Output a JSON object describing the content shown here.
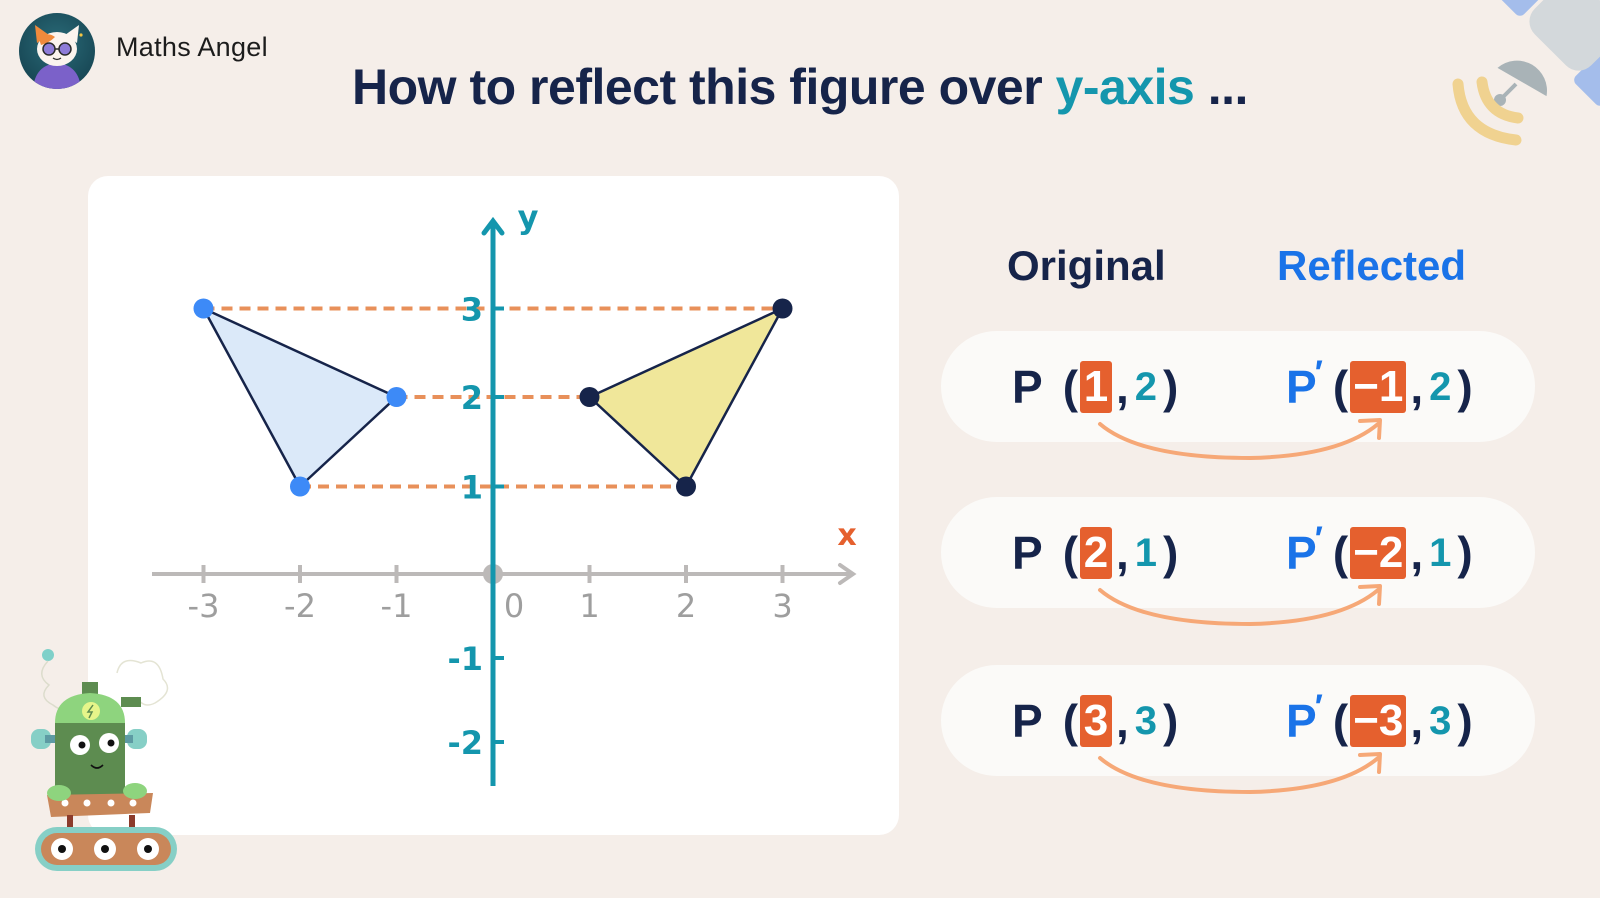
{
  "brand": {
    "name": "Maths Angel",
    "logo_icon": "cat-with-sunglasses-avatar"
  },
  "title": {
    "prefix": "How to reflect this figure over ",
    "highlight": "y-axis",
    "suffix": " ..."
  },
  "decorations": {
    "top_right": "satellite-icon",
    "bottom_left": "robot-mascot-icon"
  },
  "colors": {
    "background": "#f5eee9",
    "title": "#16244a",
    "accent_teal": "#1496ad",
    "accent_blue": "#1a73e8",
    "highlight_orange": "#e5602e",
    "dashed_orange": "#e8905a",
    "original_fill": "#dbe9f9",
    "reflected_fill": "#f0e79a"
  },
  "table": {
    "headers": {
      "original": "Original",
      "reflected": "Reflected"
    },
    "rows": [
      {
        "orig_name": "P",
        "orig_x": "1",
        "orig_y": "2",
        "refl_name": "P",
        "refl_prime": "′",
        "refl_x": "−1",
        "refl_y": "2"
      },
      {
        "orig_name": "P",
        "orig_x": "2",
        "orig_y": "1",
        "refl_name": "P",
        "refl_prime": "′",
        "refl_x": "−2",
        "refl_y": "1"
      },
      {
        "orig_name": "P",
        "orig_x": "3",
        "orig_y": "3",
        "refl_name": "P",
        "refl_prime": "′",
        "refl_x": "−3",
        "refl_y": "3"
      }
    ]
  },
  "chart_data": {
    "type": "scatter",
    "title": "",
    "xlabel": "x",
    "ylabel": "y",
    "xlim": [
      -3.5,
      3.8
    ],
    "ylim": [
      -2.4,
      3.6
    ],
    "x_ticks": [
      "-3",
      "-2",
      "-1",
      "0",
      "1",
      "2",
      "3"
    ],
    "y_ticks": [
      "3",
      "2",
      "1",
      "-1",
      "-2"
    ],
    "origin_label": "0",
    "grid": false,
    "series": [
      {
        "name": "original",
        "shape": "triangle",
        "points": [
          [
            -3,
            3
          ],
          [
            -1,
            2
          ],
          [
            -2,
            1
          ]
        ],
        "fill": "#dbe9f9",
        "point_color": "#3d8af7"
      },
      {
        "name": "reflected",
        "shape": "triangle",
        "points": [
          [
            3,
            3
          ],
          [
            1,
            2
          ],
          [
            2,
            1
          ]
        ],
        "fill": "#f0e79a",
        "point_color": "#16244a"
      }
    ],
    "guides": [
      {
        "y": 3,
        "from_x": -3,
        "to_x": 3
      },
      {
        "y": 2,
        "from_x": -1,
        "to_x": 1
      },
      {
        "y": 1,
        "from_x": -2,
        "to_x": 2
      }
    ]
  }
}
